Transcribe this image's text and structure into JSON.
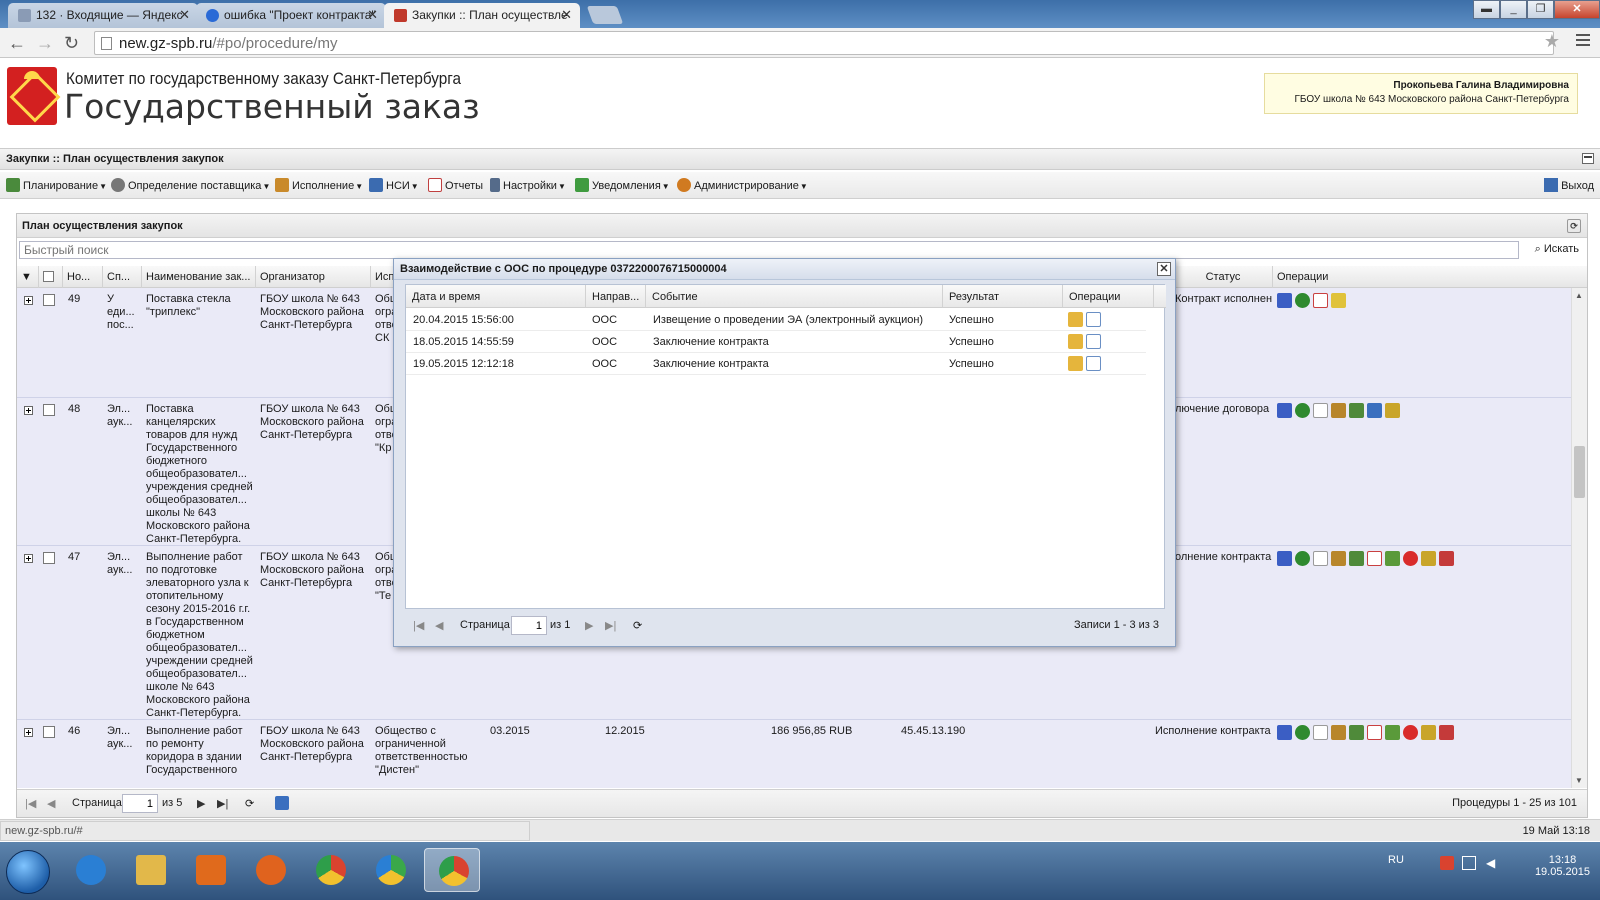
{
  "browser": {
    "tabs": [
      {
        "title": "132 · Входящие — Яндекс",
        "active": false,
        "favicon_color": "#8a9bb5"
      },
      {
        "title": "ошибка \"Проект контракта\"",
        "active": false,
        "favicon_color": "#2a6ad6"
      },
      {
        "title": "Закупки :: План осуществле",
        "active": true,
        "favicon_color": "#c0392b"
      }
    ],
    "url_host": "new.gz-spb.ru",
    "url_path": "/#po/procedure/my"
  },
  "site": {
    "subtitle": "Комитет по государственному заказу Санкт-Петербурга",
    "title": "Государственный заказ",
    "user_name": "Прокопьева Галина Владимировна",
    "user_org": "ГБОУ школа № 643 Московского района Санкт-Петербурга"
  },
  "app": {
    "section_title": "Закупки :: План осуществления закупок",
    "menu": [
      {
        "label": "Планирование",
        "icon": "planning-icon",
        "color": "#4a8a3c",
        "caret": true
      },
      {
        "label": "Определение поставщика",
        "icon": "gears-icon",
        "color": "#777777",
        "caret": true
      },
      {
        "label": "Исполнение",
        "icon": "execution-icon",
        "color": "#c98a2b",
        "caret": true
      },
      {
        "label": "НСИ",
        "icon": "book-icon",
        "color": "#3b6bb0",
        "caret": true
      },
      {
        "label": "Отчеты",
        "icon": "report-icon",
        "color": "#c04040",
        "caret": false
      },
      {
        "label": "Настройки",
        "icon": "wrench-icon",
        "color": "#556b8a",
        "caret": true
      },
      {
        "label": "Уведомления",
        "icon": "notification-icon",
        "color": "#3f9b3f",
        "caret": true
      },
      {
        "label": "Администрирование",
        "icon": "admin-icon",
        "color": "#d07a20",
        "caret": true
      }
    ],
    "exit_label": "Выход"
  },
  "panel": {
    "title": "План осуществления закупок",
    "search_placeholder": "Быстрый поиск",
    "search_button": "Искать",
    "columns": {
      "number": "Но...",
      "method": "Сп...",
      "name": "Наименование зак...",
      "organizer": "Организатор",
      "executor": "Исп",
      "status": "Статус",
      "operations": "Операции"
    },
    "rows": [
      {
        "number": "49",
        "method": "У\nеди...\nпос...",
        "name": "Поставка стекла\n\"триплекс\"",
        "organizer": "ГБОУ школа № 643\nМосковского района\nСанкт-Петербурга",
        "executor": "Общ\nогра\nотве\nСК",
        "status": "Контракт исполнен",
        "extra": {
          "start": "",
          "end": "",
          "price": "",
          "okpd": ""
        },
        "op_colors": [
          "#3b5ec4",
          "#2f8a2f",
          "#c94040",
          "#e0c23a"
        ]
      },
      {
        "number": "48",
        "method": "Эл...\nаук...",
        "name": "Поставка\nканцелярских\nтоваров для нужд\nГосударственного\nбюджетного\nобщеобразовател...\nучреждения средней\nобщеобразовател...\nшколы № 643\nМосковского района\nСанкт-Петербурга.",
        "organizer": "ГБОУ школа № 643\nМосковского района\nСанкт-Петербурга",
        "executor": "Общ\nогра\nотве\n\"Кр",
        "status": "лючение договора",
        "extra": {
          "start": "",
          "end": "",
          "price": "",
          "okpd": ""
        },
        "op_colors": [
          "#3b5ec4",
          "#2f8a2f",
          "#9a9a9a",
          "#b8862b",
          "#4f8a3a",
          "#3a6fbf",
          "#c9a52a"
        ]
      },
      {
        "number": "47",
        "method": "Эл...\nаук...",
        "name": "Выполнение работ\nпо подготовке\nэлеваторного узла к\nотопительному\nсезону 2015-2016 г.г.\nв Государственном\nбюджетном\nобщеобразовател...\nучреждении средней\nобщеобразовател...\nшколе № 643\nМосковского района\nСанкт-Петербурга.",
        "organizer": "ГБОУ школа № 643\nМосковского района\nСанкт-Петербурга",
        "executor": "Общ\nогра\nотве\n\"Те",
        "status": "олнение контракта",
        "extra": {
          "start": "",
          "end": "",
          "price": "",
          "okpd": ""
        },
        "op_colors": [
          "#3b5ec4",
          "#2f8a2f",
          "#9a9a9a",
          "#b8862b",
          "#4f8a3a",
          "#c94040",
          "#5a9a3a",
          "#d92b2b",
          "#c9a52a",
          "#c43a3a"
        ]
      },
      {
        "number": "46",
        "method": "Эл...\nаук...",
        "name": "Выполнение работ\nпо ремонту\nкоридора в здании\nГосударственного",
        "organizer": "ГБОУ школа № 643\nМосковского района\nСанкт-Петербурга",
        "executor": "Общество с\nограниченной\nответственностью\n\"Дистен\"",
        "status": "Исполнение контракта",
        "extra": {
          "start": "03.2015",
          "end": "12.2015",
          "price": "186 956,85 RUB",
          "okpd": "45.45.13.190"
        },
        "op_colors": [
          "#3b5ec4",
          "#2f8a2f",
          "#9a9a9a",
          "#b8862b",
          "#4f8a3a",
          "#c94040",
          "#5a9a3a",
          "#d92b2b",
          "#c9a52a",
          "#c43a3a"
        ]
      }
    ],
    "pager": {
      "page_label": "Страница",
      "page": "1",
      "of_label": "из 5",
      "summary": "Процедуры 1 - 25 из 101"
    }
  },
  "modal": {
    "title": "Взаимодействие с ООС по процедуре 0372200076715000004",
    "columns": {
      "datetime": "Дата и время",
      "direction": "Направ...",
      "event": "Событие",
      "result": "Результат",
      "operations": "Операции"
    },
    "rows": [
      {
        "datetime": "20.04.2015 15:56:00",
        "direction": "ООС",
        "event": "Извещение о проведении ЭА (электронный аукцион)",
        "result": "Успешно"
      },
      {
        "datetime": "18.05.2015 14:55:59",
        "direction": "ООС",
        "event": "Заключение контракта",
        "result": "Успешно"
      },
      {
        "datetime": "19.05.2015 12:12:18",
        "direction": "ООС",
        "event": "Заключение контракта",
        "result": "Успешно"
      }
    ],
    "pager": {
      "page_label": "Страница",
      "page": "1",
      "of_label": "из 1",
      "summary": "Записи 1 - 3 из 3"
    }
  },
  "status": {
    "url": "new.gz-spb.ru/#",
    "datetime": "19 Май 13:18"
  },
  "taskbar": {
    "apps": [
      {
        "name": "ie-icon",
        "color": "#2a7fd4",
        "active": false
      },
      {
        "name": "explorer-icon",
        "color": "#e2b84a",
        "active": false
      },
      {
        "name": "media-player-icon",
        "color": "#e06a1c",
        "active": false
      },
      {
        "name": "firefox-icon",
        "color": "#e0631e",
        "active": false
      },
      {
        "name": "chrome-icon",
        "color": "#d9432f",
        "active": false
      },
      {
        "name": "triangle-app-icon",
        "color": "#3aa84a",
        "active": false
      },
      {
        "name": "chrome-active-icon",
        "color": "#d9432f",
        "active": true
      }
    ],
    "lang": "RU",
    "time": "13:18",
    "date": "19.05.2015"
  }
}
